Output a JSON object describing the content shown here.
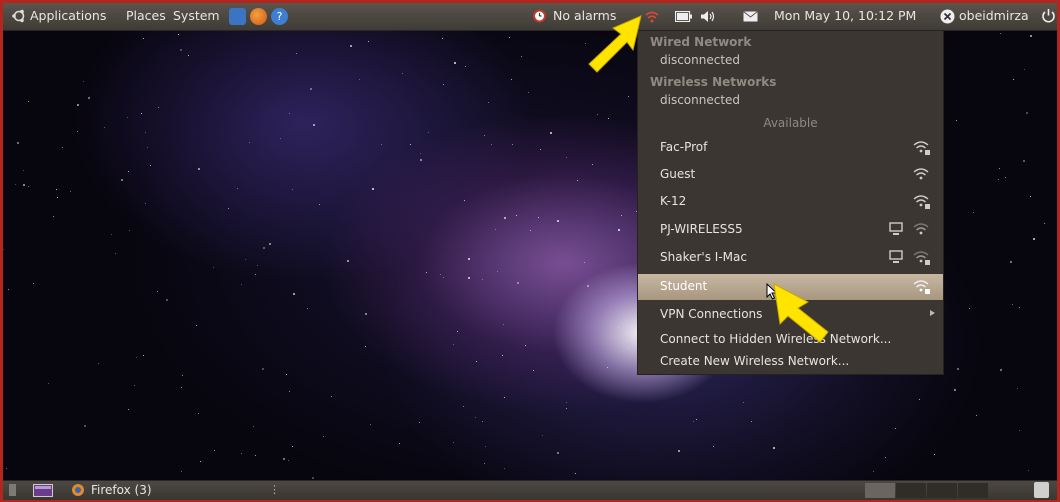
{
  "top_panel": {
    "menus": [
      "Applications",
      "Places",
      "System"
    ],
    "alarm_label": "No alarms",
    "datetime": "Mon May 10, 10:12 PM",
    "username": "obeidmirza"
  },
  "network_menu": {
    "wired_header": "Wired Network",
    "wired_status": "disconnected",
    "wireless_header": "Wireless Networks",
    "wireless_status": "disconnected",
    "available_label": "Available",
    "networks": [
      {
        "name": "Fac-Prof",
        "secured": true,
        "adhoc": false
      },
      {
        "name": "Guest",
        "secured": false,
        "adhoc": false
      },
      {
        "name": "K-12",
        "secured": true,
        "adhoc": false
      },
      {
        "name": "PJ-WIRELESS5",
        "secured": false,
        "adhoc": true
      },
      {
        "name": "Shaker's I-Mac",
        "secured": true,
        "adhoc": true
      },
      {
        "name": "Student",
        "secured": true,
        "adhoc": false,
        "selected": true
      }
    ],
    "vpn_label": "VPN Connections",
    "hidden_label": "Connect to Hidden Wireless Network...",
    "create_label": "Create New Wireless Network..."
  },
  "bottom_panel": {
    "taskbar_item": "Firefox (3)"
  },
  "colors": {
    "panel": "#4a453f",
    "menu_bg": "#3b3631",
    "selected": "#b8a891",
    "annotation_arrow": "#ffe400",
    "frame": "#b3261e"
  }
}
